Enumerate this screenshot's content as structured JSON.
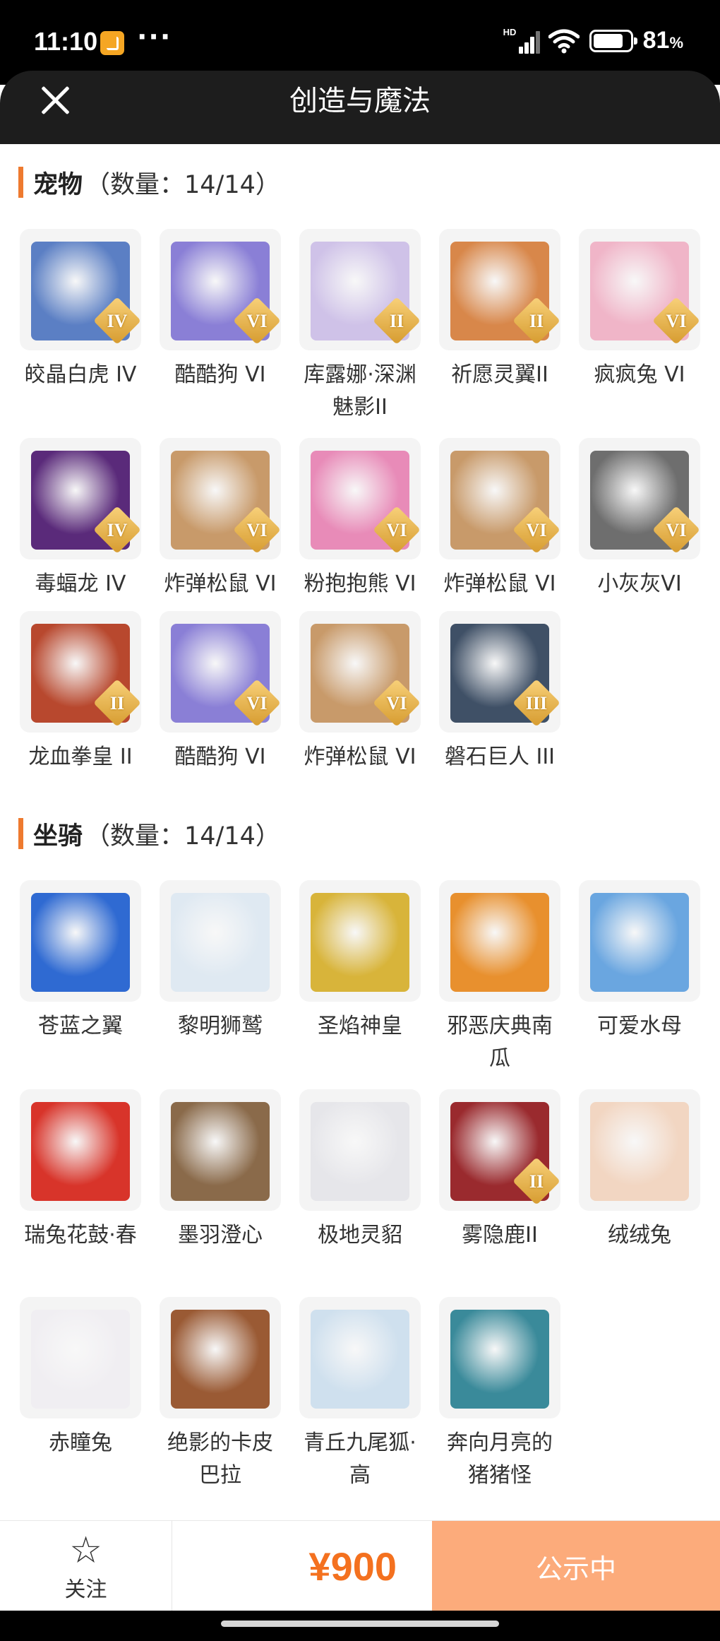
{
  "status_bar": {
    "time": "11:10",
    "network": "HD",
    "battery_pct": "81",
    "battery_unit": "%",
    "battery_level": 0.81
  },
  "header": {
    "title": "创造与魔法"
  },
  "pets": {
    "name": "宠物",
    "count_label": "（数量：14/14）",
    "items": [
      {
        "label": "皎晶白虎 IV",
        "level": "IV",
        "color": "#5b7fc4",
        "icon": "tiger-icon"
      },
      {
        "label": "酷酷狗 VI",
        "level": "VI",
        "color": "#8a7fd6",
        "icon": "dog-icon"
      },
      {
        "label": "库露娜·深渊魅影II",
        "level": "II",
        "color": "#cfc2e8",
        "icon": "spirit-icon"
      },
      {
        "label": "祈愿灵翼II",
        "level": "II",
        "color": "#d8874a",
        "icon": "bird-icon"
      },
      {
        "label": "疯疯兔 VI",
        "level": "VI",
        "color": "#f0b5c8",
        "icon": "rabbit-icon"
      },
      {
        "label": "毒蝠龙 IV",
        "level": "IV",
        "color": "#5a2a7a",
        "icon": "dragon-icon"
      },
      {
        "label": "炸弹松鼠 VI",
        "level": "VI",
        "color": "#c89a6a",
        "icon": "squirrel-icon"
      },
      {
        "label": "粉抱抱熊 VI",
        "level": "VI",
        "color": "#e88bb8",
        "icon": "bear-icon"
      },
      {
        "label": "炸弹松鼠 VI",
        "level": "VI",
        "color": "#c89a6a",
        "icon": "squirrel-icon"
      },
      {
        "label": "小灰灰VI",
        "level": "VI",
        "color": "#6e6e6e",
        "icon": "wolf-icon"
      },
      {
        "label": "龙血拳皇 II",
        "level": "II",
        "color": "#b8482e",
        "icon": "dragon-icon"
      },
      {
        "label": "酷酷狗 VI",
        "level": "VI",
        "color": "#8a7fd6",
        "icon": "dog-icon"
      },
      {
        "label": "炸弹松鼠 VI",
        "level": "VI",
        "color": "#c89a6a",
        "icon": "squirrel-icon"
      },
      {
        "label": "磐石巨人 III",
        "level": "III",
        "color": "#3f5066",
        "icon": "golem-icon"
      }
    ]
  },
  "mounts": {
    "name": "坐骑",
    "count_label": "（数量：14/14）",
    "items": [
      {
        "label": "苍蓝之翼",
        "color": "#2f6ad2",
        "icon": "griffin-icon"
      },
      {
        "label": "黎明狮鹫",
        "color": "#dfe9f2",
        "icon": "griffin-icon"
      },
      {
        "label": "圣焰神皇",
        "color": "#d8b43a",
        "icon": "phoenix-icon"
      },
      {
        "label": "邪恶庆典南瓜",
        "color": "#e8902e",
        "icon": "pumpkin-icon"
      },
      {
        "label": "可爱水母",
        "color": "#6aa6e0",
        "icon": "jellyfish-icon"
      },
      {
        "label": "瑞兔花鼓·春",
        "color": "#d8342a",
        "icon": "drum-icon"
      },
      {
        "label": "墨羽澄心",
        "color": "#8a6a4a",
        "icon": "feather-icon"
      },
      {
        "label": "极地灵貂",
        "color": "#e6e6ea",
        "icon": "ermine-icon"
      },
      {
        "label": "雾隐鹿II",
        "level": "II",
        "color": "#9a2a2e",
        "icon": "deer-icon"
      },
      {
        "label": "绒绒兔",
        "color": "#f2d6c2",
        "icon": "rabbit-icon"
      },
      {
        "label": "赤瞳兔",
        "color": "#f0eef2",
        "icon": "rabbit-icon"
      },
      {
        "label": "绝影的卡皮巴拉",
        "color": "#9a5a34",
        "icon": "capybara-icon"
      },
      {
        "label": "青丘九尾狐·高",
        "color": "#cfe0ee",
        "icon": "fox-icon"
      },
      {
        "label": "奔向月亮的猪猪怪",
        "color": "#3a8a9a",
        "icon": "pig-icon"
      }
    ]
  },
  "bottom_bar": {
    "follow_label": "关注",
    "price": "¥900",
    "status_label": "公示中"
  }
}
